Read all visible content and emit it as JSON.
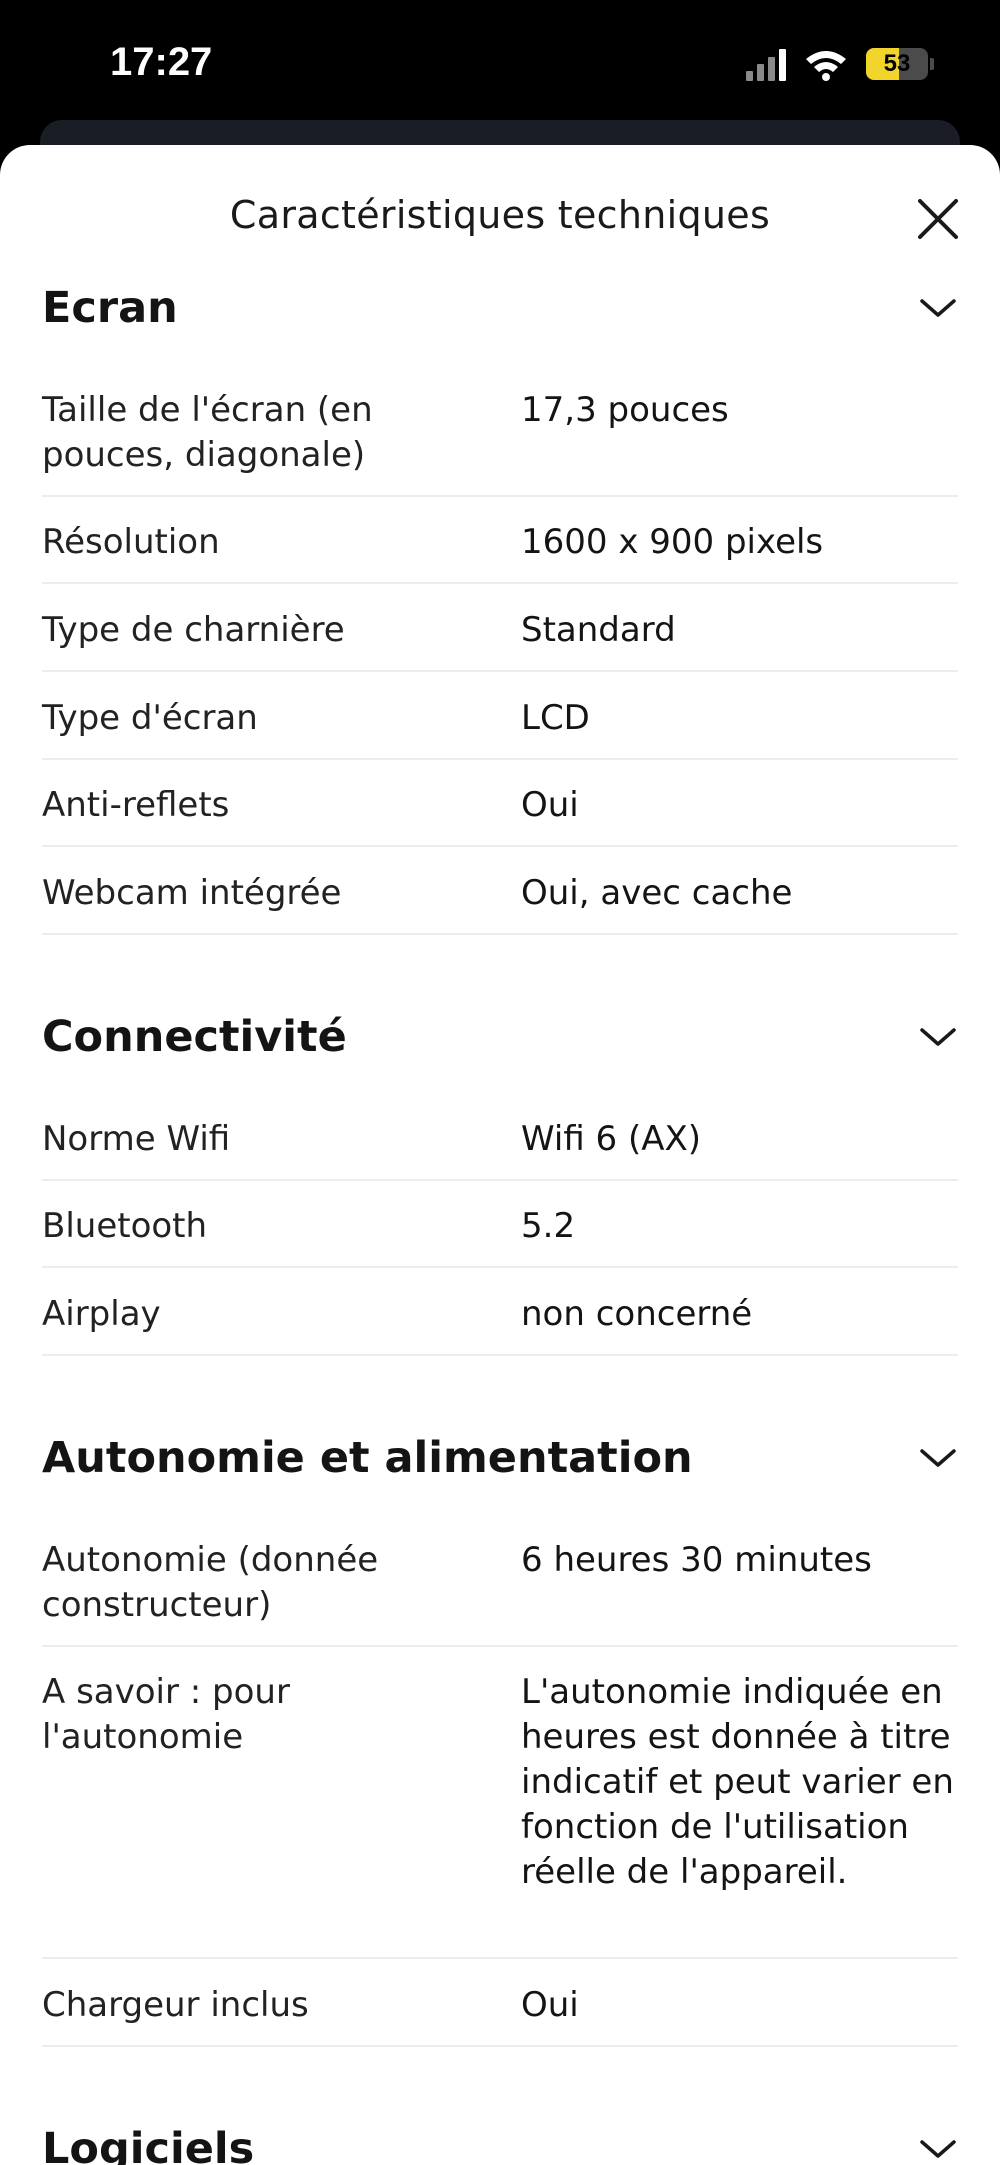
{
  "status_bar": {
    "time": "17:27",
    "battery": "53",
    "battery_level": 0.53,
    "battery_color": "#f2d52b"
  },
  "sheet": {
    "title": "Caractéristiques techniques",
    "close_icon": "close-icon"
  },
  "sections": [
    {
      "title": "Ecran",
      "rows": [
        {
          "label": "Taille de l'écran (en pouces, diagonale)",
          "value": "17,3 pouces"
        },
        {
          "label": "Résolution",
          "value": "1600 x 900 pixels"
        },
        {
          "label": "Type de charnière",
          "value": "Standard"
        },
        {
          "label": "Type d'écran",
          "value": "LCD"
        },
        {
          "label": "Anti-reflets",
          "value": "Oui"
        },
        {
          "label": "Webcam intégrée",
          "value": "Oui, avec cache"
        }
      ]
    },
    {
      "title": "Connectivité",
      "rows": [
        {
          "label": "Norme Wifi",
          "value": "Wifi 6 (AX)"
        },
        {
          "label": "Bluetooth",
          "value": "5.2"
        },
        {
          "label": "Airplay",
          "value": "non concerné"
        }
      ]
    },
    {
      "title": "Autonomie et alimentation",
      "rows": [
        {
          "label": "Autonomie (donnée constructeur)",
          "value": "6 heures 30 minutes"
        },
        {
          "label": "A savoir : pour l'autonomie",
          "value": "L'autonomie indiquée en heures est donnée à titre indicatif et peut varier en fonction de l'utilisation réelle de l'appareil."
        },
        {
          "label": "Chargeur inclus",
          "value": "Oui"
        }
      ]
    },
    {
      "title": "Logiciels",
      "rows": []
    }
  ]
}
